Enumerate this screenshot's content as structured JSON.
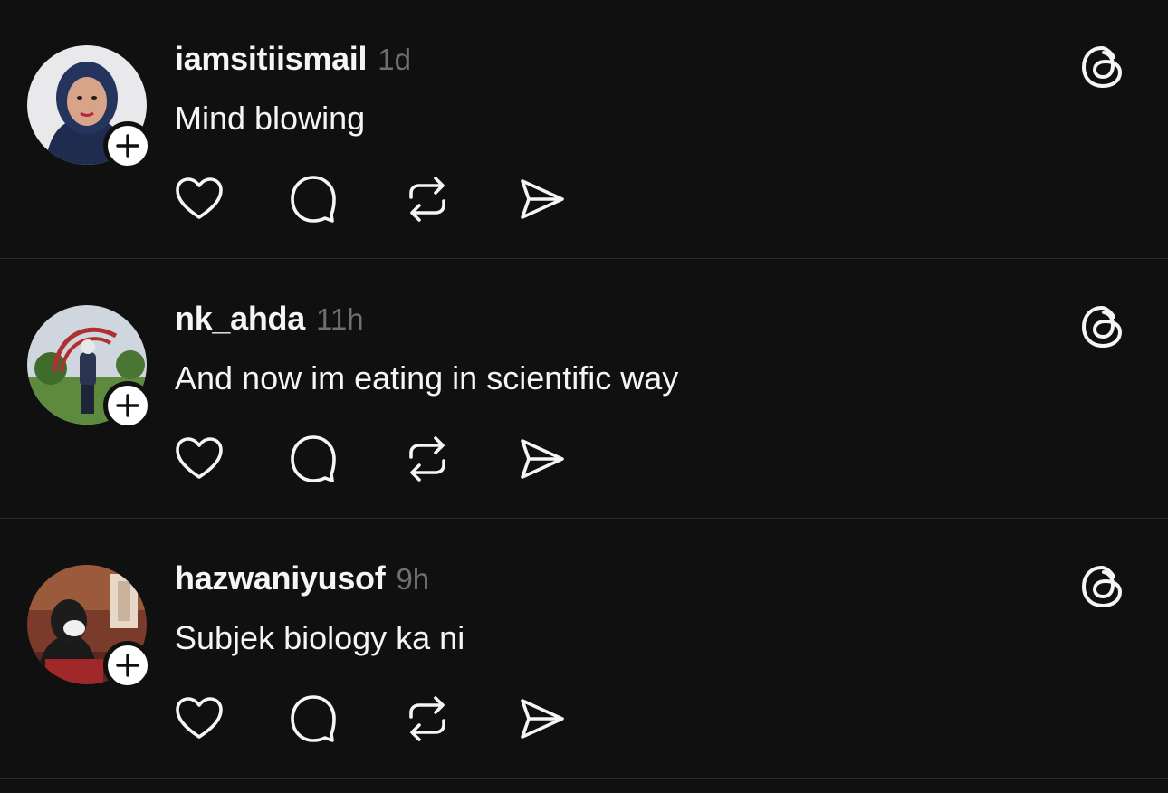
{
  "feed": {
    "posts": [
      {
        "username": "iamsitiismail",
        "timestamp": "1d",
        "text": "Mind blowing",
        "avatar_icon": "avatar-hijab-woman",
        "accent": "#1e2a4a"
      },
      {
        "username": "nk_ahda",
        "timestamp": "11h",
        "text": "And now im eating in scientific way",
        "avatar_icon": "avatar-outdoor-park",
        "accent": "#4f7a3a"
      },
      {
        "username": "hazwaniyusof",
        "timestamp": "9h",
        "text": "Subjek biology ka ni",
        "avatar_icon": "avatar-cafe-interior",
        "accent": "#8a2b2b"
      }
    ],
    "actions": [
      "heart-icon",
      "comment-icon",
      "repost-icon",
      "share-icon"
    ],
    "colors": {
      "background": "#101010",
      "text": "#f3f5f7",
      "muted": "#6f6f6f",
      "divider": "#2b2b2b",
      "icon": "#f3f5f7"
    }
  }
}
